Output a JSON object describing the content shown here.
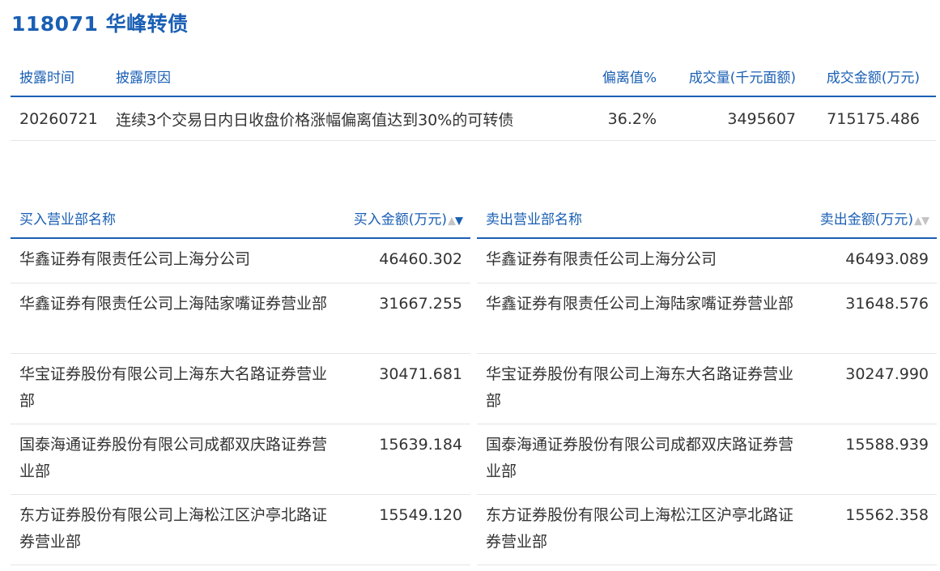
{
  "title": "118071 华峰转债",
  "info": {
    "headers": {
      "date": "披露时间",
      "reason": "披露原因",
      "deviation": "偏离值%",
      "volume": "成交量(千元面额)",
      "amount": "成交金额(万元)"
    },
    "row": {
      "date": "20260721",
      "reason": "连续3个交易日内日收盘价格涨幅偏离值达到30%的可转债",
      "deviation": "36.2%",
      "volume": "3495607",
      "amount": "715175.486"
    }
  },
  "buy": {
    "header_name": "买入营业部名称",
    "header_amount": "买入金额(万元)",
    "sort_up": "▲",
    "sort_down": "▼",
    "rows": [
      {
        "name": "华鑫证券有限责任公司上海分公司",
        "amount": "46460.302"
      },
      {
        "name": "华鑫证券有限责任公司上海陆家嘴证券营业部",
        "amount": "31667.255"
      },
      {
        "name": "华宝证券股份有限公司上海东大名路证券营业部",
        "amount": "30471.681"
      },
      {
        "name": "国泰海通证券股份有限公司成都双庆路证券营业部",
        "amount": "15639.184"
      },
      {
        "name": "东方证券股份有限公司上海松江区沪亭北路证券营业部",
        "amount": "15549.120"
      }
    ]
  },
  "sell": {
    "header_name": "卖出营业部名称",
    "header_amount": "卖出金额(万元)",
    "sort_up": "▲",
    "sort_down": "▼",
    "rows": [
      {
        "name": "华鑫证券有限责任公司上海分公司",
        "amount": "46493.089"
      },
      {
        "name": "华鑫证券有限责任公司上海陆家嘴证券营业部",
        "amount": "31648.576"
      },
      {
        "name": "华宝证券股份有限公司上海东大名路证券营业部",
        "amount": "30247.990"
      },
      {
        "name": "国泰海通证券股份有限公司成都双庆路证券营业部",
        "amount": "15588.939"
      },
      {
        "name": "东方证券股份有限公司上海松江区沪亭北路证券营业部",
        "amount": "15562.358"
      }
    ]
  },
  "colors": {
    "accent": "#1a5fb4",
    "text": "#333333",
    "divider": "#e5e5e5",
    "sort_inactive": "#c4c4c4"
  }
}
